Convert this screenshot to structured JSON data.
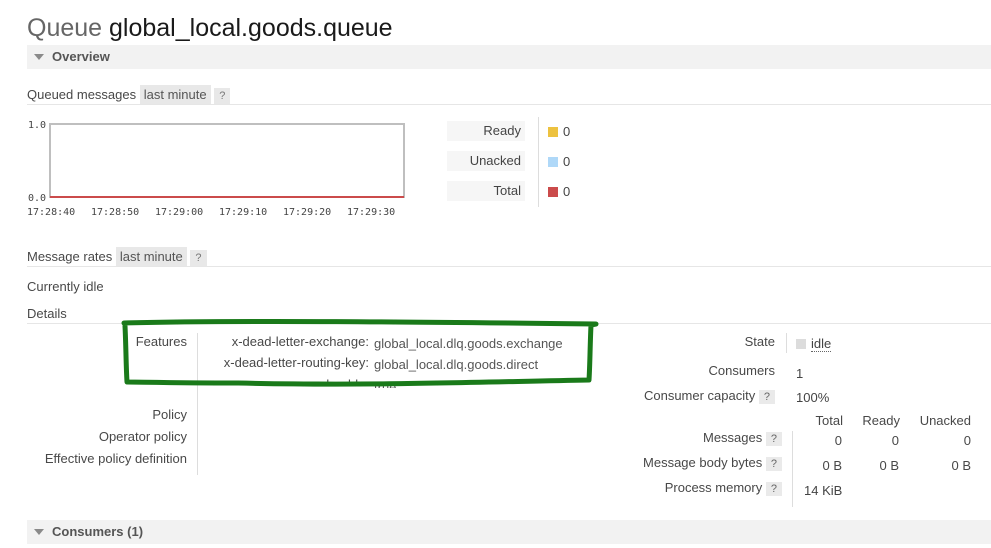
{
  "page": {
    "title_prefix": "Queue",
    "title_name": "global_local.goods.queue"
  },
  "overview": {
    "section_label": "Overview",
    "queued_label": "Queued messages",
    "queued_range": "last minute",
    "help": "?",
    "legend": [
      {
        "label": "Ready",
        "value": "0",
        "color": "#edc240"
      },
      {
        "label": "Unacked",
        "value": "0",
        "color": "#afd8f8"
      },
      {
        "label": "Total",
        "value": "0",
        "color": "#cb4b4b"
      }
    ],
    "rates_label": "Message rates",
    "rates_range": "last minute",
    "idle_text": "Currently idle"
  },
  "chart_data": {
    "type": "line",
    "x": [
      "17:28:40",
      "17:28:50",
      "17:29:00",
      "17:29:10",
      "17:29:20",
      "17:29:30"
    ],
    "y_ticks": [
      "1.0",
      "0.0"
    ],
    "ylim": [
      0,
      1
    ],
    "series": [
      {
        "name": "Ready",
        "values": [
          0,
          0,
          0,
          0,
          0,
          0
        ],
        "color": "#edc240"
      },
      {
        "name": "Unacked",
        "values": [
          0,
          0,
          0,
          0,
          0,
          0
        ],
        "color": "#afd8f8"
      },
      {
        "name": "Total",
        "values": [
          0,
          0,
          0,
          0,
          0,
          0
        ],
        "color": "#cb4b4b"
      }
    ]
  },
  "details": {
    "label": "Details",
    "features_label": "Features",
    "features": [
      {
        "key": "x-dead-letter-exchange:",
        "value": "global_local.dlq.goods.exchange"
      },
      {
        "key": "x-dead-letter-routing-key:",
        "value": "global_local.dlq.goods.direct"
      }
    ],
    "durable_partial": "durable:",
    "durable_value": "true",
    "policy_label": "Policy",
    "operator_policy_label": "Operator policy",
    "effective_policy_label": "Effective policy definition",
    "state_label": "State",
    "state_value": "idle",
    "consumers_label": "Consumers",
    "consumers_value": "1",
    "capacity_label": "Consumer capacity",
    "capacity_value": "100%",
    "help": "?",
    "table_headers": [
      "Total",
      "Ready",
      "Unacked"
    ],
    "rows": [
      {
        "label": "Messages",
        "values": [
          "0",
          "0",
          "0"
        ]
      },
      {
        "label": "Message body bytes",
        "values": [
          "0 B",
          "0 B",
          "0 B"
        ]
      },
      {
        "label": "Process memory",
        "values": [
          "14 KiB"
        ]
      }
    ],
    "annotation_color": "#1a7a1a"
  },
  "consumers": {
    "section_label": "Consumers (1)"
  }
}
